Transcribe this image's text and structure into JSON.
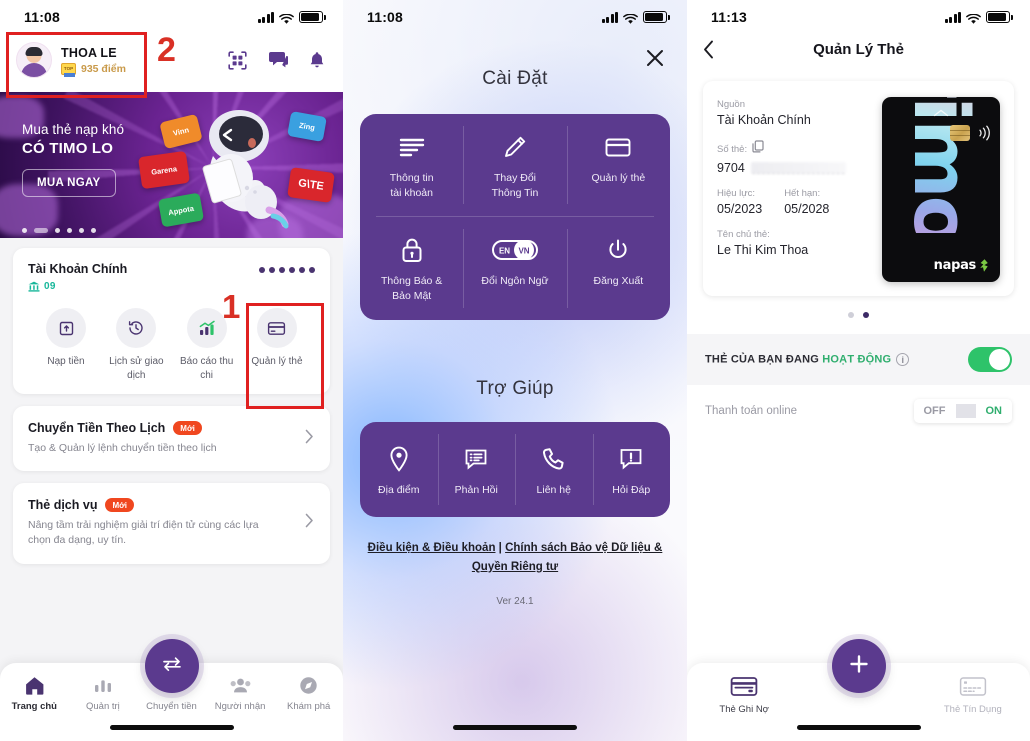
{
  "screen1": {
    "status": {
      "time": "11:08"
    },
    "header": {
      "user_name": "THOA LE",
      "points": "935 điểm",
      "points_badge": "TOP",
      "icons": [
        "qr-scan-icon",
        "chat-icon",
        "bell-icon"
      ]
    },
    "annotation_2": "2",
    "annotation_1": "1",
    "promo": {
      "line1": "Mua thẻ nạp khó",
      "line2": "CÓ TIMO LO",
      "button": "MUA NGAY",
      "game_cards": [
        {
          "name": "Vinn",
          "color": "#f08b2a"
        },
        {
          "name": "Zing",
          "color": "#3aa0e0"
        },
        {
          "name": "Garena",
          "color": "#d9262c"
        },
        {
          "name": "GATE",
          "color": "#d9262c"
        },
        {
          "name": "Appota",
          "color": "#2bab5b"
        }
      ]
    },
    "account": {
      "title": "Tài Khoản Chính",
      "number": "09",
      "balance_hidden": true
    },
    "quick_actions": [
      {
        "label": "Nạp tiền",
        "icon": "deposit-icon"
      },
      {
        "label": "Lịch sử\ngiao dịch",
        "icon": "history-icon"
      },
      {
        "label": "Báo cáo\nthu chi",
        "icon": "report-chart-icon"
      },
      {
        "label": "Quản lý\nthẻ",
        "icon": "card-icon"
      }
    ],
    "service_rows": [
      {
        "title": "Chuyển Tiền Theo Lịch",
        "badge": "Mới",
        "subtitle": "Tạo & Quản lý lệnh chuyển tiền theo lịch"
      },
      {
        "title": "Thẻ dịch vụ",
        "badge": "Mới",
        "subtitle": "Nâng tầm trải nghiệm giải trí điện tử cùng các lựa chọn đa dạng, uy tín."
      }
    ],
    "tabbar": [
      {
        "label": "Trang chủ",
        "icon": "home-icon",
        "active": true
      },
      {
        "label": "Quản trị",
        "icon": "bar-chart-icon",
        "active": false
      },
      {
        "label": "Chuyển tiền",
        "icon": "transfer-icon",
        "active": false
      },
      {
        "label": "Người nhận",
        "icon": "people-icon",
        "active": false
      },
      {
        "label": "Khám phá",
        "icon": "compass-icon",
        "active": false
      }
    ],
    "fab_icon": "transfer-arrows-icon"
  },
  "screen2": {
    "status": {
      "time": "11:08"
    },
    "close_icon": "close-icon",
    "settings_title": "Cài Đặt",
    "settings_items": [
      {
        "label": "Thông tin\ntài khoản",
        "icon": "list-lines-icon"
      },
      {
        "label": "Thay Đổi\nThông Tin",
        "icon": "pencil-icon"
      },
      {
        "label": "Quản lý thẻ",
        "icon": "card-icon"
      },
      {
        "label": "Thông Báo &\nBảo Mật",
        "icon": "lock-icon"
      },
      {
        "label": "Đổi Ngôn Ngữ",
        "icon": "language-toggle-icon"
      },
      {
        "label": "Đăng Xuất",
        "icon": "power-icon"
      }
    ],
    "lang_toggle": {
      "off": "EN",
      "on": "VN"
    },
    "help_title": "Trợ Giúp",
    "help_items": [
      {
        "label": "Địa điểm",
        "icon": "location-pin-icon"
      },
      {
        "label": "Phản Hồi",
        "icon": "feedback-icon"
      },
      {
        "label": "Liên hệ",
        "icon": "phone-icon"
      },
      {
        "label": "Hỏi Đáp",
        "icon": "faq-icon"
      }
    ],
    "legal_link_1": "Điều kiện & Điều khoản",
    "legal_separator": " | ",
    "legal_link_2": "Chính sách Bảo vệ Dữ liệu & Quyền Riêng tư",
    "version": "Ver 24.1"
  },
  "screen3": {
    "status": {
      "time": "11:13"
    },
    "nav": {
      "back_icon": "chevron-left-icon",
      "title": "Quản Lý Thẻ"
    },
    "card": {
      "source_label": "Nguồn",
      "source_value": "Tài Khoản Chính",
      "number_label": "Số thẻ:",
      "copy_icon": "copy-icon",
      "number_value": "9704",
      "valid_label": "Hiệu lực:",
      "valid_value": "05/2023",
      "expiry_label": "Hết hạn:",
      "expiry_value": "05/2028",
      "holder_label": "Tên chủ thẻ:",
      "holder_value": "Le Thi Kim Thoa",
      "brand": "timo",
      "network": "napas"
    },
    "pager": {
      "count": 2,
      "active_index": 1
    },
    "status_row": {
      "prefix": "THẺ CỦA BẠN ĐANG ",
      "state": "HOẠT ĐỘNG",
      "info_icon": "info-icon",
      "toggle_on": true
    },
    "online_row": {
      "label": "Thanh toán online",
      "off": "OFF",
      "on": "ON",
      "selected": "ON"
    },
    "tabbar": [
      {
        "label": "Thẻ Ghi Nợ",
        "icon": "debit-card-icon",
        "active": true
      },
      {
        "label": "Thẻ Tín Dụng",
        "icon": "credit-card-icon",
        "active": false
      }
    ],
    "fab_icon": "plus-icon"
  },
  "colors": {
    "brand_purple": "#5b3a8e",
    "accent_green": "#2ec36a",
    "alert_red": "#e02020",
    "badge_orange": "#f0471f"
  }
}
